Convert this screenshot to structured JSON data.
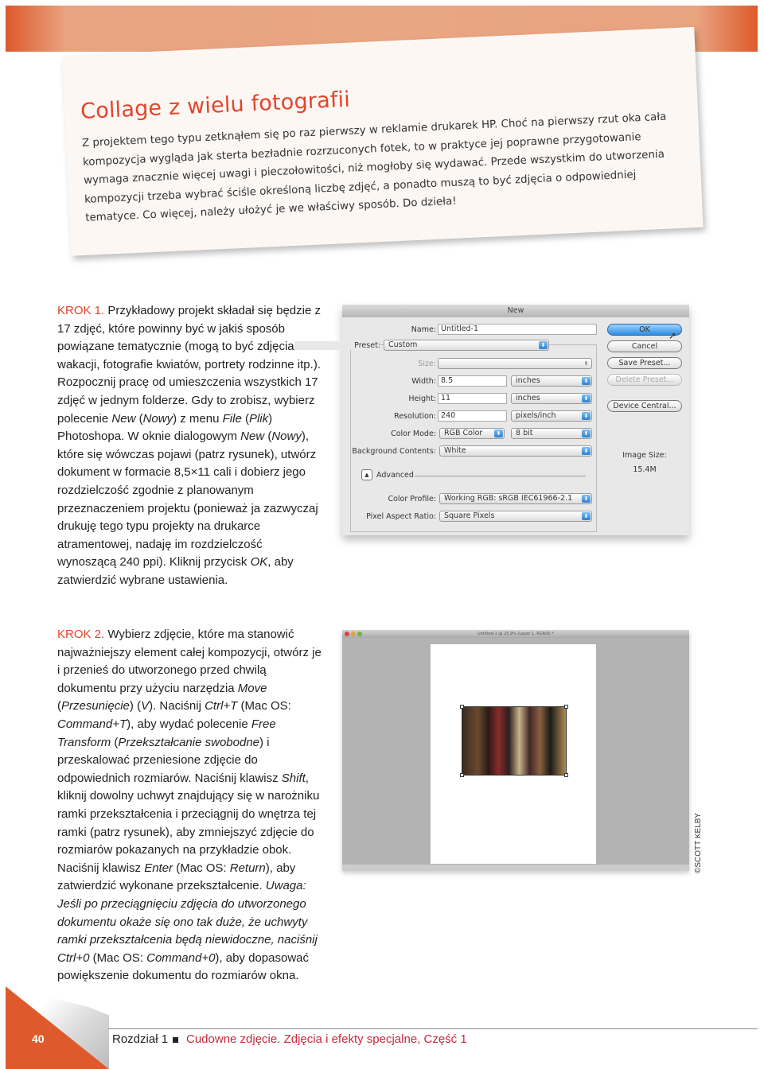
{
  "intro": {
    "title": "Collage z wielu fotografii",
    "body": "Z projektem tego typu zetknąłem się po raz pierwszy w reklamie drukarek HP. Choć na pierwszy rzut oka cała kompozycja wygląda jak sterta bezładnie rozrzuconych fotek, to w praktyce jej poprawne przygotowanie wymaga znacznie więcej uwagi i pieczołowitości, niż mogłoby się wydawać. Przede wszystkim do utworzenia kompozycji trzeba wybrać ściśle określoną liczbę zdjęć, a ponadto muszą to być zdjęcia o odpowiedniej tematyce. Co więcej, należy ułożyć je we właściwy sposób. Do dzieła!"
  },
  "steps": [
    {
      "label": "KROK 1.",
      "segments": [
        {
          "t": " Przykładowy projekt składał się będzie z 17 zdjęć, które powinny być w jakiś sposób powiązane tematycznie (mogą to być zdjęcia z wakacji, fotografie kwiatów, portrety rodzinne itp.). Rozpocznij pracę od umieszczenia wszystkich 17 zdjęć w jednym folderze. Gdy to zrobisz, wybierz polecenie "
        },
        {
          "t": "New",
          "i": true
        },
        {
          "t": " ("
        },
        {
          "t": "Nowy",
          "i": true
        },
        {
          "t": ") z menu "
        },
        {
          "t": "File",
          "i": true
        },
        {
          "t": " ("
        },
        {
          "t": "Plik",
          "i": true
        },
        {
          "t": ") Photoshopa. W oknie dialogowym "
        },
        {
          "t": "New",
          "i": true
        },
        {
          "t": " ("
        },
        {
          "t": "Nowy",
          "i": true
        },
        {
          "t": "), które się wówczas pojawi (patrz rysunek), utwórz dokument w formacie 8,5×11 cali i dobierz jego rozdzielczość zgodnie z planowanym przeznaczeniem projektu (ponieważ ja zazwyczaj drukuję tego typu projekty na drukarce atramentowej, nadaję im rozdzielczość wynoszącą 240 ppi). Kliknij przycisk "
        },
        {
          "t": "OK",
          "i": true
        },
        {
          "t": ", aby zatwierdzić wybrane ustawienia."
        }
      ]
    },
    {
      "label": "KROK 2.",
      "segments": [
        {
          "t": " Wybierz zdjęcie, które ma stanowić najważniejszy element całej kompozycji, otwórz je i przenieś do utworzonego przed chwilą dokumentu przy użyciu narzędzia "
        },
        {
          "t": "Move",
          "i": true
        },
        {
          "t": " ("
        },
        {
          "t": "Przesunięcie",
          "i": true
        },
        {
          "t": ") ("
        },
        {
          "t": "V",
          "i": true
        },
        {
          "t": "). Naciśnij "
        },
        {
          "t": "Ctrl+T",
          "i": true
        },
        {
          "t": " (Mac OS: "
        },
        {
          "t": "Command+T",
          "i": true
        },
        {
          "t": "), aby wydać polecenie "
        },
        {
          "t": "Free Transform",
          "i": true
        },
        {
          "t": " ("
        },
        {
          "t": "Przekształcanie swobodne",
          "i": true
        },
        {
          "t": ") i przeskalować przeniesione zdjęcie do odpowiednich rozmiarów. Naciśnij klawisz "
        },
        {
          "t": "Shift",
          "i": true
        },
        {
          "t": ", kliknij dowolny uchwyt znajdujący się w narożniku ramki przekształcenia i przeciągnij do wnętrza tej ramki (patrz rysunek), aby zmniejszyć zdjęcie do rozmiarów pokazanych na przykładzie obok. Naciśnij klawisz "
        },
        {
          "t": "Enter",
          "i": true
        },
        {
          "t": " (Mac OS: "
        },
        {
          "t": "Return",
          "i": true
        },
        {
          "t": "), aby zatwierdzić wykonane przekształcenie. "
        },
        {
          "t": "Uwaga:",
          "i": true
        },
        {
          "t": " "
        },
        {
          "t": "Jeśli po przeciągnięciu zdjęcia do utworzonego dokumentu okaże się ono tak duże, że uchwyty ramki przekształcenia będą niewidoczne, naciśnij",
          "i": true
        },
        {
          "t": " "
        },
        {
          "t": "Ctrl+0",
          "i": true
        },
        {
          "t": " (Mac OS: "
        },
        {
          "t": "Command+0",
          "i": true
        },
        {
          "t": "), aby dopasować powiększenie dokumentu do rozmiarów okna."
        }
      ]
    }
  ],
  "dialog": {
    "title": "New",
    "name_label": "Name:",
    "name_value": "Untitled-1",
    "preset_label": "Preset:",
    "preset_value": "Custom",
    "size_label": "Size:",
    "width_label": "Width:",
    "width_value": "8.5",
    "width_unit": "inches",
    "height_label": "Height:",
    "height_value": "11",
    "height_unit": "inches",
    "resolution_label": "Resolution:",
    "resolution_value": "240",
    "resolution_unit": "pixels/inch",
    "color_mode_label": "Color Mode:",
    "color_mode_value": "RGB Color",
    "bit_depth": "8 bit",
    "background_label": "Background Contents:",
    "background_value": "White",
    "advanced_label": "Advanced",
    "color_profile_label": "Color Profile:",
    "color_profile_value": "Working RGB:  sRGB IEC61966-2.1",
    "pixel_aspect_label": "Pixel Aspect Ratio:",
    "pixel_aspect_value": "Square Pixels",
    "ok": "OK",
    "cancel": "Cancel",
    "save_preset": "Save Preset...",
    "delete_preset": "Delete Preset...",
    "device_central": "Device Central...",
    "image_size_label": "Image Size:",
    "image_size_value": "15.4M"
  },
  "document_window": {
    "title": "Untitled-1 @ 25.9% (Layer 1, RGB/8) *"
  },
  "credit": "©SCOTT KELBY",
  "footer": {
    "page": "40",
    "chapter": "Rozdział 1",
    "title": "Cudowne zdjęcie. Zdjęcia i efekty specjalne, Część 1"
  },
  "colors": {
    "accent": "#e2452b",
    "banner": "#e9a683",
    "footer_title": "#c8283a"
  }
}
